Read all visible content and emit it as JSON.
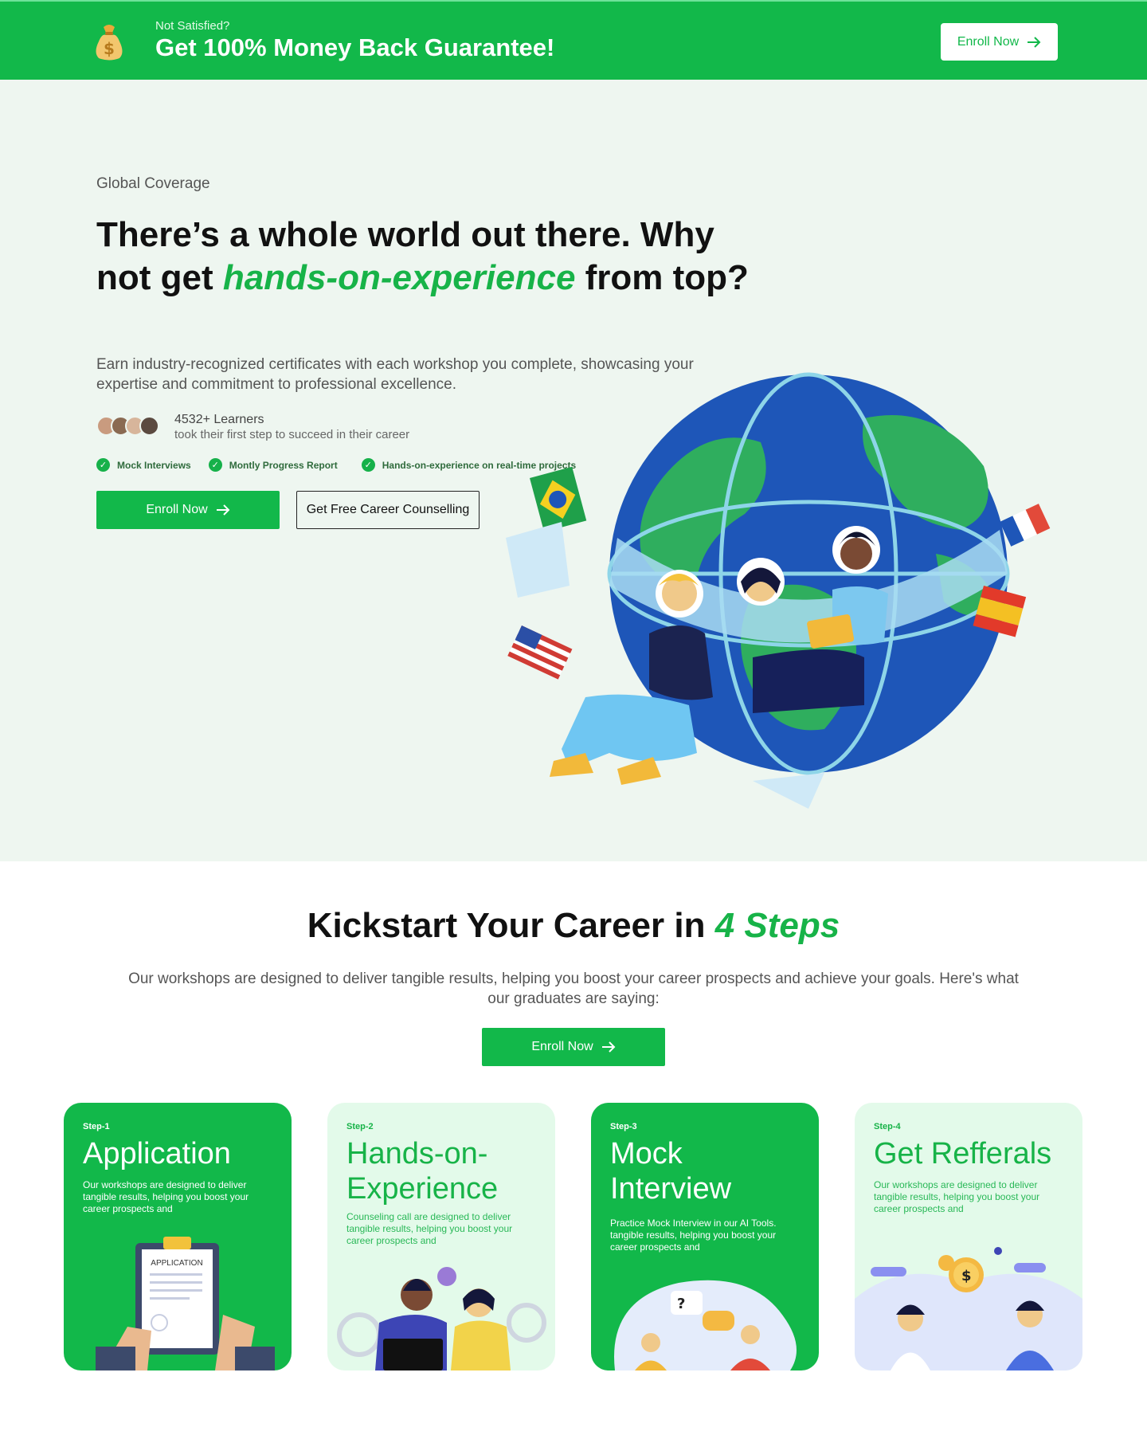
{
  "banner": {
    "eyebrow": "Not Satisfied?",
    "title": "Get 100% Money Back Guarantee!",
    "enroll_label": "Enroll Now"
  },
  "hero": {
    "eyebrow": "Global Coverage",
    "headline_part1": "There’s a whole world out there. Why not get ",
    "headline_accent": "hands-on-experience",
    "headline_part2": " from top?",
    "description": "Earn industry-recognized certificates with each workshop you complete, showcasing your expertise and commitment to professional excellence.",
    "learners_count": "4532+ Learners",
    "learners_sub": "took their first step to succeed in their career",
    "features": [
      "Mock Interviews",
      "Montly Progress Report",
      "Hands-on-experience on real-time projects"
    ],
    "enroll_label": "Enroll Now",
    "counselling_label": "Get Free Career Counselling",
    "illustration_icon": "globe-students-illustration"
  },
  "steps": {
    "title_part1": "Kickstart Your Career in ",
    "title_accent": "4 Steps",
    "description": "Our workshops are designed to deliver tangible results, helping you boost your career prospects and achieve your goals. Here's what our graduates are saying:",
    "enroll_label": "Enroll Now",
    "cards": [
      {
        "step": "Step-1",
        "title": "Application",
        "desc": "Our workshops are designed to deliver tangible results, helping you boost your career prospects and",
        "illustration_text": "APPLICATION"
      },
      {
        "step": "Step-2",
        "title": "Hands-on-Experience",
        "desc": "Counseling call are designed to deliver tangible results, helping you boost your career prospects and"
      },
      {
        "step": "Step-3",
        "title": "Mock Interview",
        "desc": "Practice Mock Interview in our AI Tools. tangible results, helping you boost your career prospects and"
      },
      {
        "step": "Step-4",
        "title": "Get Refferals",
        "desc": "Our workshops are designed to deliver tangible results, helping you boost your career prospects and"
      }
    ]
  },
  "colors": {
    "brand_green": "#12b84a",
    "hero_bg": "#eef6f0",
    "card_light": "#e3faea"
  }
}
